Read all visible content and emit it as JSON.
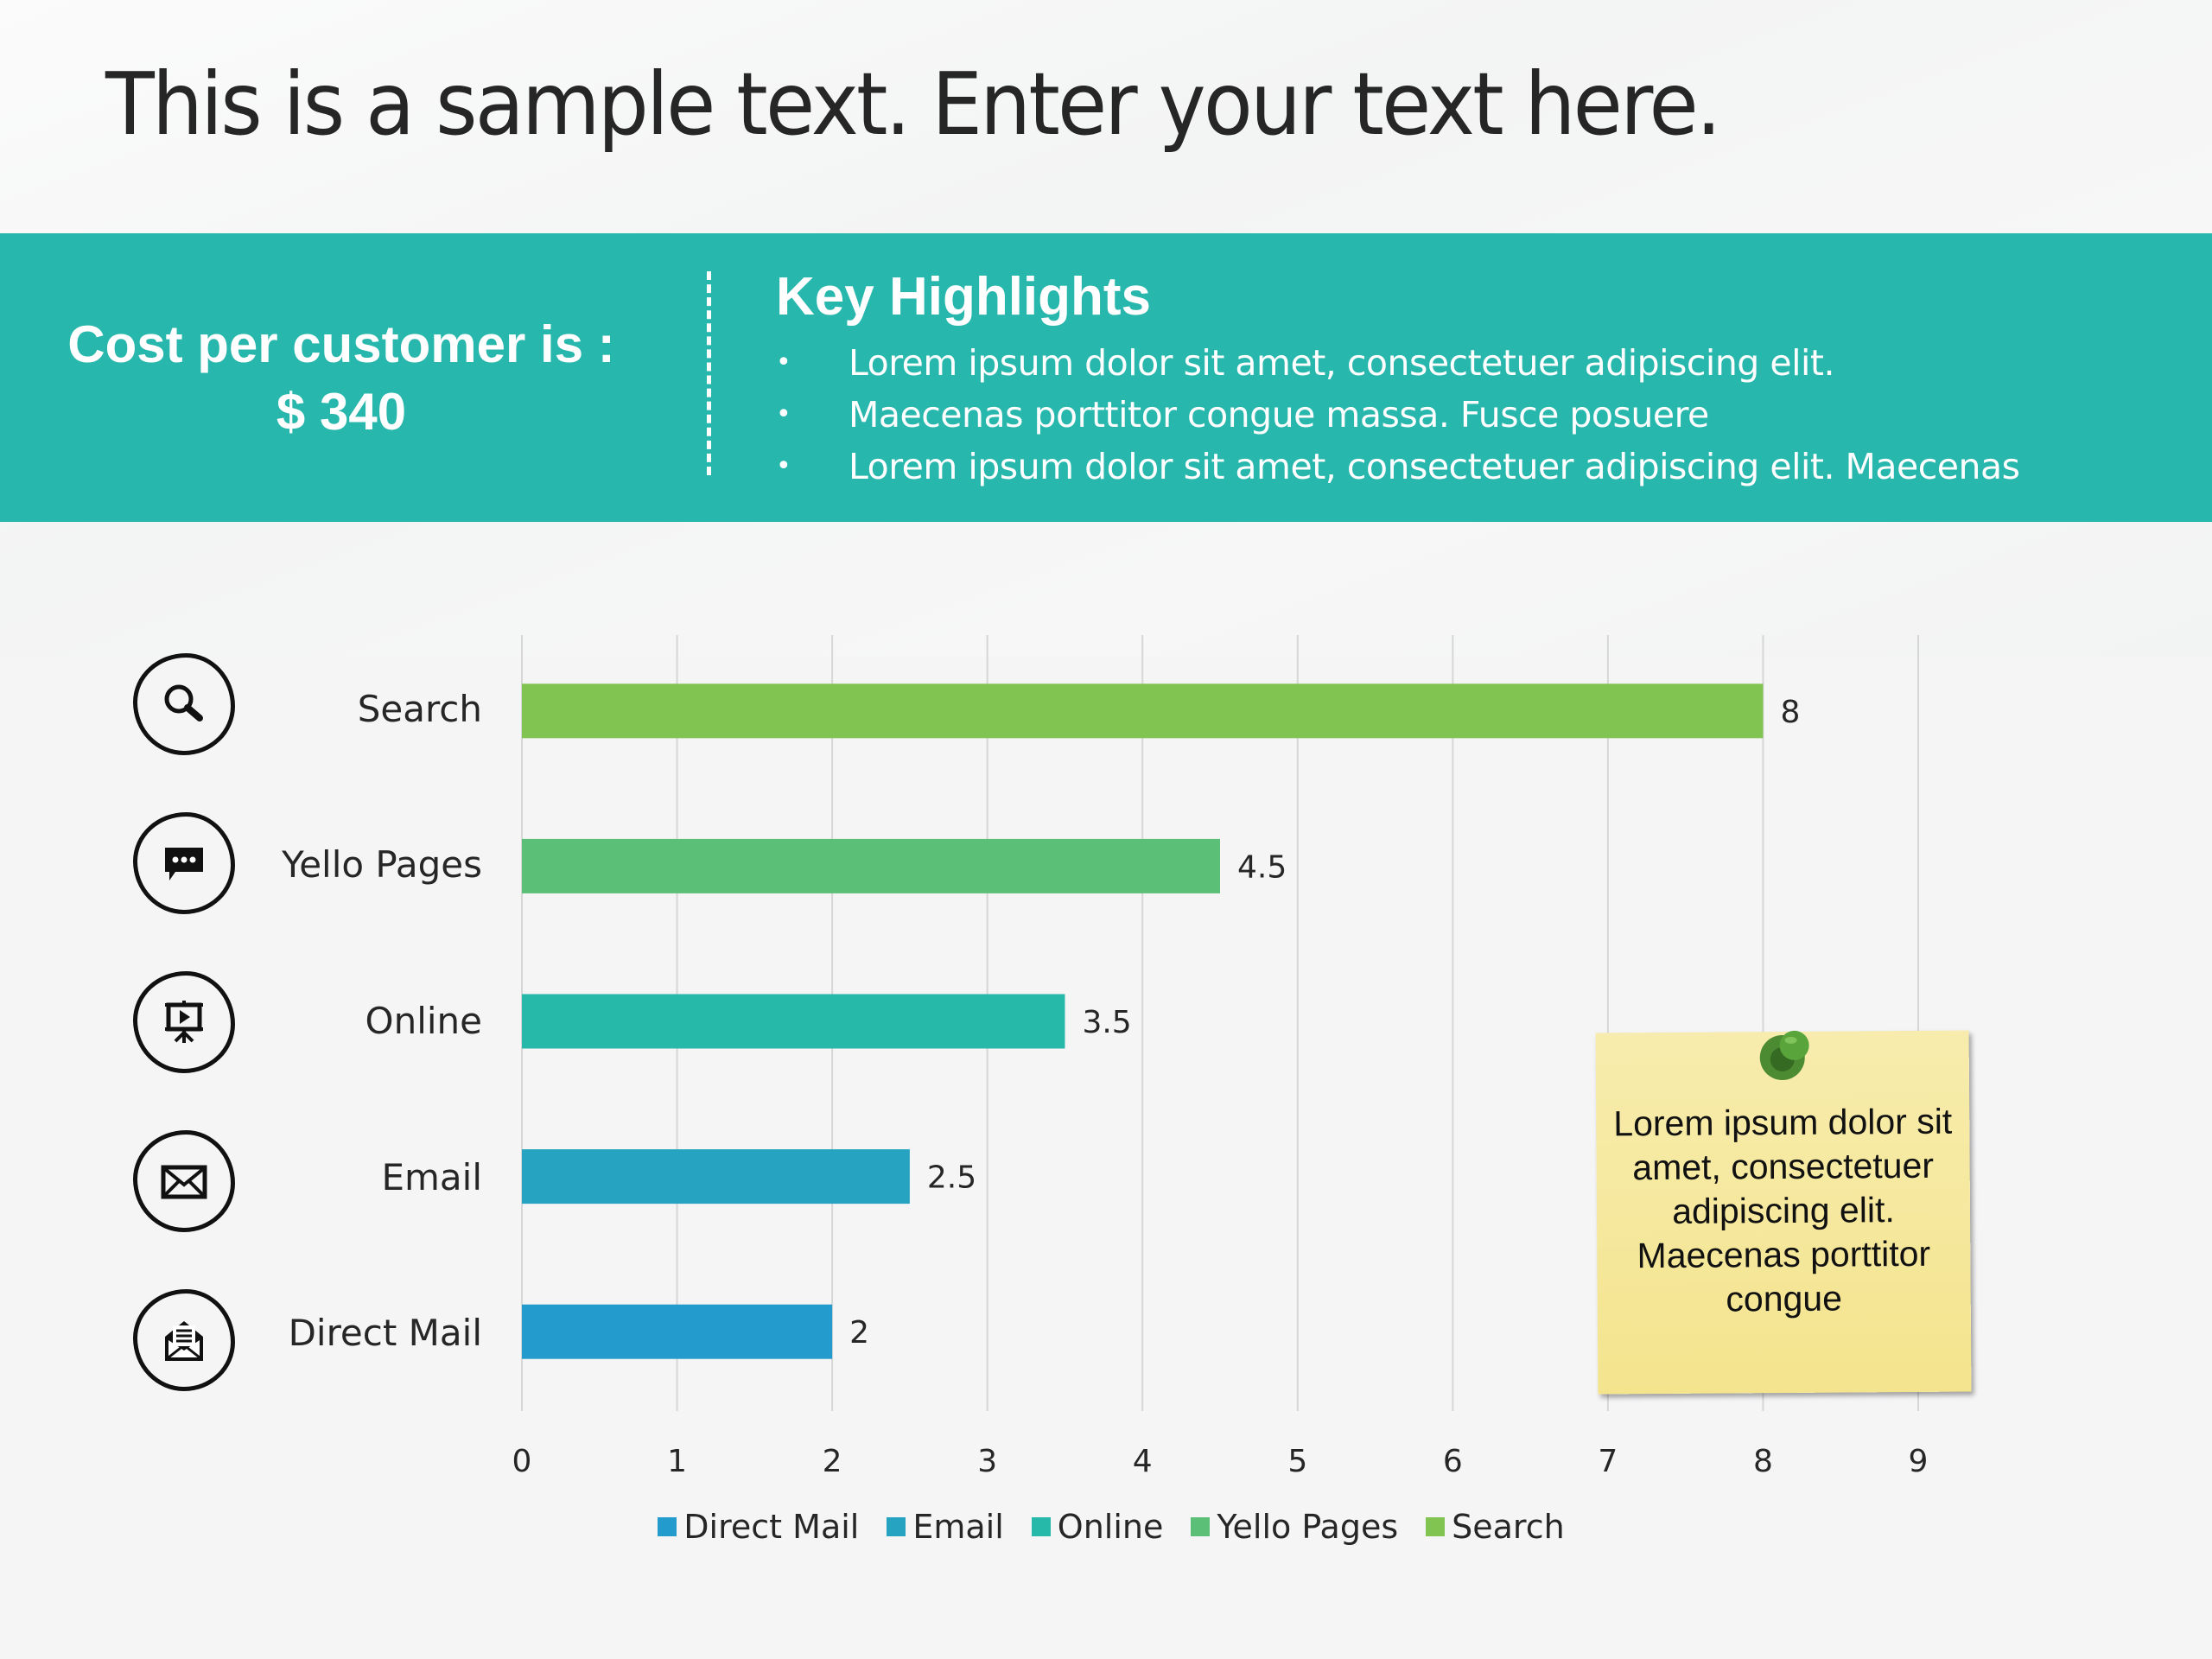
{
  "title": "This is a sample text. Enter your text here.",
  "banner": {
    "cost_label": "Cost per customer is :",
    "cost_value": "$ 340",
    "highlights_title": "Key Highlights",
    "highlights": [
      "Lorem ipsum dolor sit amet, consectetuer adipiscing elit.",
      "Maecenas porttitor congue massa. Fusce posuere",
      "Lorem ipsum dolor sit amet, consectetuer adipiscing elit. Maecenas"
    ],
    "bullet": "•",
    "color": "#28b7ac"
  },
  "icons": [
    {
      "category": "Search",
      "icon": "search-icon"
    },
    {
      "category": "Yello Pages",
      "icon": "chat-bubble-icon"
    },
    {
      "category": "Online",
      "icon": "presentation-play-icon"
    },
    {
      "category": "Email",
      "icon": "envelope-icon"
    },
    {
      "category": "Direct Mail",
      "icon": "open-envelope-letter-icon"
    }
  ],
  "note": {
    "text": "Lorem ipsum dolor sit amet, consectetuer adipiscing elit. Maecenas porttitor congue",
    "color": "#f6e89e"
  },
  "chart_data": {
    "type": "bar",
    "orientation": "horizontal",
    "title": "",
    "xlabel": "",
    "ylabel": "",
    "categories": [
      "Search",
      "Yello Pages",
      "Online",
      "Email",
      "Direct Mail"
    ],
    "series": [
      {
        "name": "Direct Mail",
        "category": "Direct Mail",
        "value": 2,
        "color": "#239bcc"
      },
      {
        "name": "Email",
        "category": "Email",
        "value": 2.5,
        "color": "#27a3c2"
      },
      {
        "name": "Online",
        "category": "Online",
        "value": 3.5,
        "color": "#26b8a8"
      },
      {
        "name": "Yello Pages",
        "category": "Yello Pages",
        "value": 4.5,
        "color": "#5bbf78"
      },
      {
        "name": "Search",
        "category": "Search",
        "value": 8,
        "color": "#82c451"
      }
    ],
    "data_labels": [
      "8",
      "4.5",
      "3.5",
      "2.5",
      "2"
    ],
    "xlim": [
      0,
      9
    ],
    "xticks": [
      "0",
      "1",
      "2",
      "3",
      "4",
      "5",
      "6",
      "7",
      "8",
      "9"
    ],
    "grid": "vertical",
    "legend_position": "bottom",
    "legend": [
      "Direct Mail",
      "Email",
      "Online",
      "Yello Pages",
      "Search"
    ]
  }
}
